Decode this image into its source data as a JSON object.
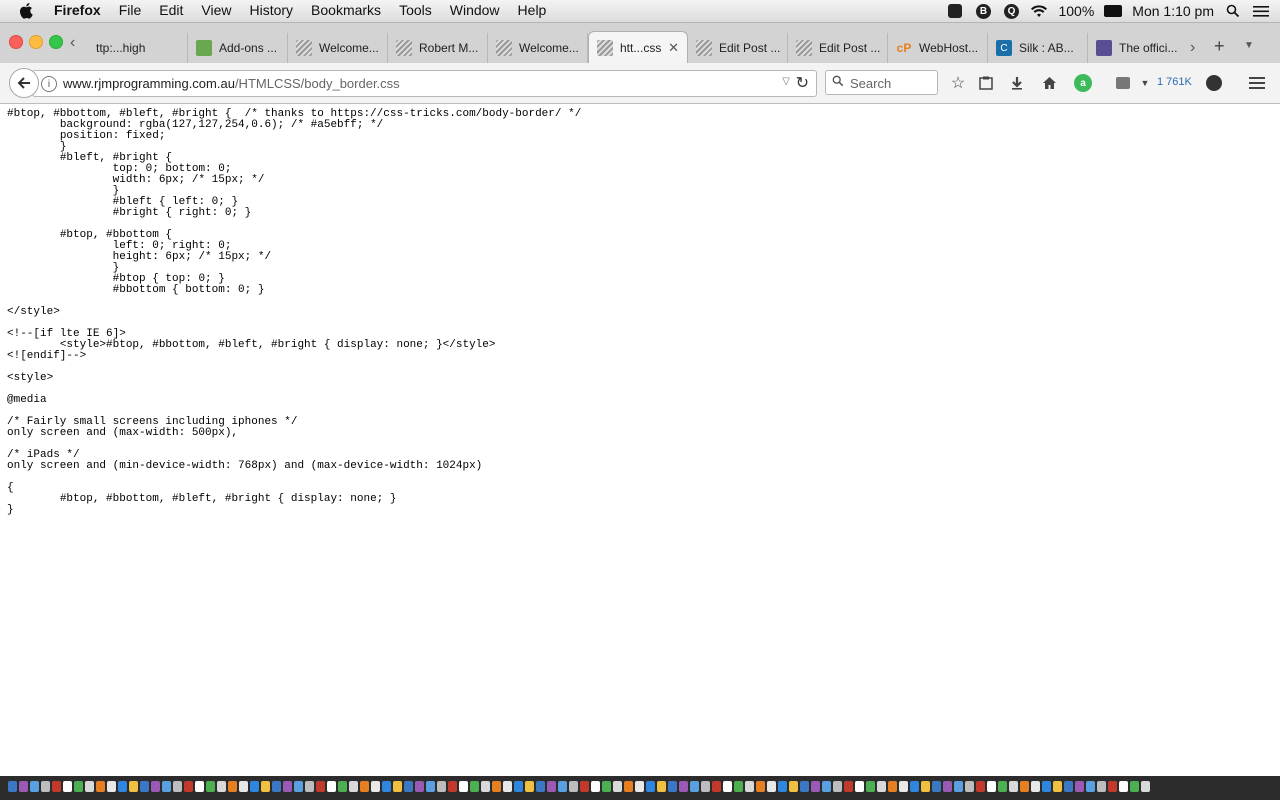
{
  "menubar": {
    "app_name": "Firefox",
    "items": [
      "File",
      "Edit",
      "View",
      "History",
      "Bookmarks",
      "Tools",
      "Window",
      "Help"
    ],
    "battery": "100%",
    "clock": "Mon 1:10 pm",
    "icons": [
      "apple-icon",
      "dropbox-icon",
      "b-icon",
      "q-icon",
      "wifi-icon",
      "battery-icon",
      "spotlight-icon",
      "notification-icon"
    ]
  },
  "tabs": [
    {
      "label": "ttp:...high",
      "favicon": "doc"
    },
    {
      "label": "Add-ons ...",
      "favicon": "puzzle"
    },
    {
      "label": "Welcome...",
      "favicon": "doc"
    },
    {
      "label": "Robert M...",
      "favicon": "doc"
    },
    {
      "label": "Welcome...",
      "favicon": "doc"
    },
    {
      "label": "htt...css",
      "favicon": "doc",
      "active": true
    },
    {
      "label": "Edit Post ...",
      "favicon": "doc"
    },
    {
      "label": "Edit Post ...",
      "favicon": "doc"
    },
    {
      "label": "WebHost...",
      "favicon": "cp"
    },
    {
      "label": "Silk : AB...",
      "favicon": "silk"
    },
    {
      "label": "The offici...",
      "favicon": "off"
    },
    {
      "label": "",
      "favicon": "doc"
    }
  ],
  "nav": {
    "url_host": "www.rjmprogramming.com.au",
    "url_path": "/HTMLCSS/body_border.css",
    "search_placeholder": "Search",
    "count_text": "1 761K"
  },
  "page": {
    "source": "#btop, #bbottom, #bleft, #bright {  /* thanks to https://css-tricks.com/body-border/ */\n\tbackground: rgba(127,127,254,0.6); /* #a5ebff; */\n\tposition: fixed;\n\t}\n\t#bleft, #bright {\n\t\ttop: 0; bottom: 0;\n\t\twidth: 6px; /* 15px; */\n\t\t}\n\t\t#bleft { left: 0; }\n\t\t#bright { right: 0; }\n\n\t#btop, #bbottom {\n\t\tleft: 0; right: 0;\n\t\theight: 6px; /* 15px; */\n\t\t}\n\t\t#btop { top: 0; }\n\t\t#bbottom { bottom: 0; }\n\n</style>\n\n<!--[if lte IE 6]>\n\t<style>#btop, #bbottom, #bleft, #bright { display: none; }</style>\n<![endif]-->\n\n<style>\n\n@media\n\n/* Fairly small screens including iphones */\nonly screen and (max-width: 500px),\n\n/* iPads */\nonly screen and (min-device-width: 768px) and (max-device-width: 1024px)\n\n{\n\t#btop, #bbottom, #bleft, #bright { display: none; }\n}"
  },
  "colors": {
    "traffic_close": "#fc605b",
    "traffic_min": "#fdbc40",
    "traffic_max": "#34c749",
    "count_blue": "#2a6bb0"
  }
}
